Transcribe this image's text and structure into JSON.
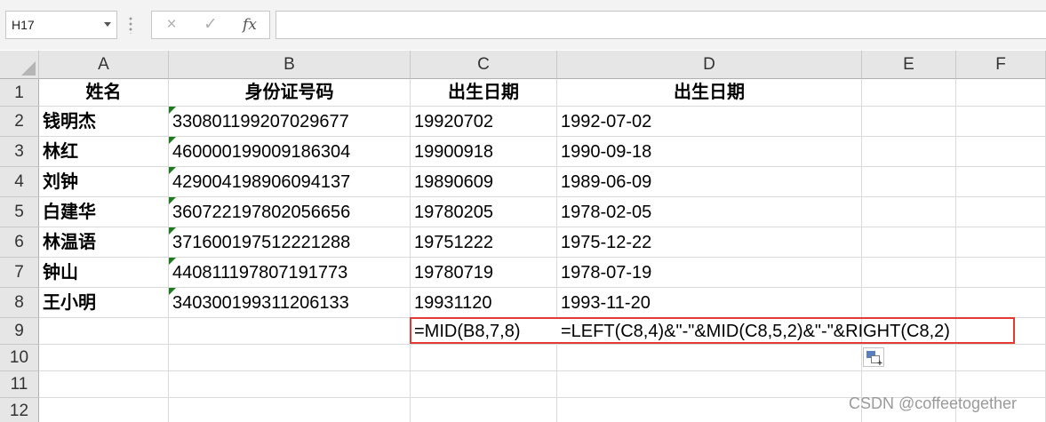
{
  "formula_bar": {
    "name_box": "H17",
    "cancel_icon": "×",
    "enter_icon": "✓",
    "fx_label": "fx",
    "formula": ""
  },
  "columns": [
    "A",
    "B",
    "C",
    "D",
    "E",
    "F"
  ],
  "rows": [
    "1",
    "2",
    "3",
    "4",
    "5",
    "6",
    "7",
    "8",
    "9",
    "10",
    "11",
    "12"
  ],
  "cells": {
    "A1": "姓名",
    "B1": "身份证号码",
    "C1": "出生日期",
    "D1": "出生日期",
    "A2": "钱明杰",
    "B2": "330801199207029677",
    "C2": "19920702",
    "D2": "1992-07-02",
    "A3": "林红",
    "B3": "460000199009186304",
    "C3": "19900918",
    "D3": "1990-09-18",
    "A4": "刘钟",
    "B4": "429004198906094137",
    "C4": "19890609",
    "D4": "1989-06-09",
    "A5": "白建华",
    "B5": "360722197802056656",
    "C5": "19780205",
    "D5": "1978-02-05",
    "A6": "林温语",
    "B6": "371600197512221288",
    "C6": "19751222",
    "D6": "1975-12-22",
    "A7": "钟山",
    "B7": "440811197807191773",
    "C7": "19780719",
    "D7": "1978-07-19",
    "A8": "王小明",
    "B8": "340300199311206133",
    "C8": "19931120",
    "D8": "1993-11-20",
    "C9": "=MID(B8,7,8)",
    "D9": "=LEFT(C8,4)&\"-\"&MID(C8,5,2)&\"-\"&RIGHT(C8,2)"
  },
  "colors": {
    "highlight": "#e23a35",
    "text_number_indicator": "#1e7a1e"
  },
  "watermark": "CSDN @coffeetogether"
}
